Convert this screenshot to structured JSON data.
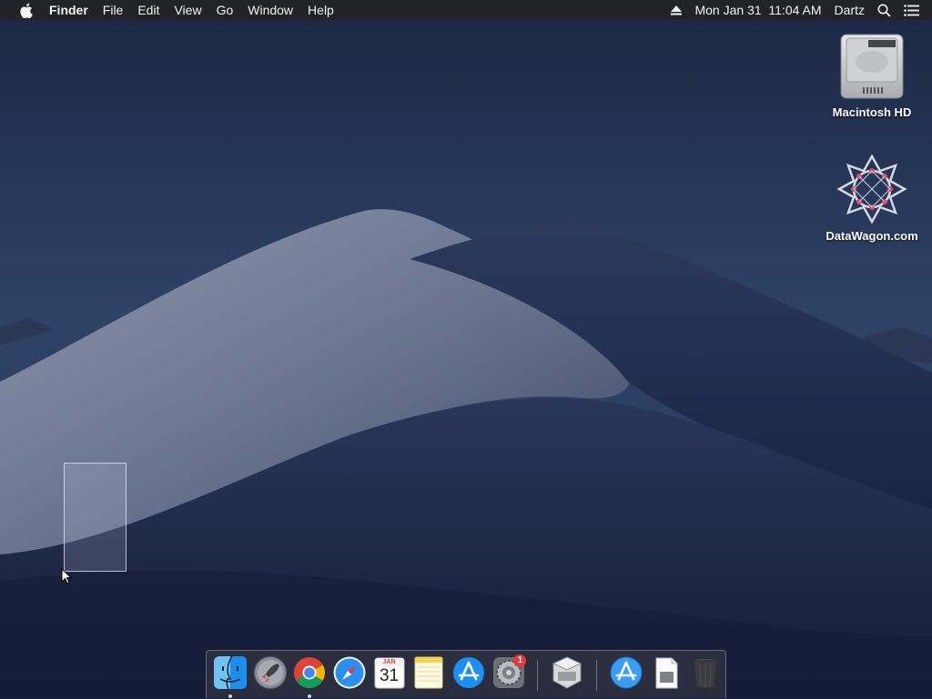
{
  "menubar": {
    "app_name": "Finder",
    "menus": [
      "File",
      "Edit",
      "View",
      "Go",
      "Window",
      "Help"
    ],
    "datetime": "Mon Jan 31  11:04 AM",
    "user": "Dartz"
  },
  "desktop_icons": [
    {
      "label": "Macintosh HD",
      "icon": "hard-drive-icon"
    },
    {
      "label": "DataWagon.com",
      "icon": "disk-image-icon"
    }
  ],
  "dock": {
    "items": [
      {
        "name": "Finder",
        "icon": "finder-icon",
        "running": true
      },
      {
        "name": "Launchpad",
        "icon": "launchpad-icon",
        "running": false
      },
      {
        "name": "Google Chrome",
        "icon": "chrome-icon",
        "running": true
      },
      {
        "name": "Safari",
        "icon": "safari-icon",
        "running": false
      },
      {
        "name": "Calendar",
        "icon": "calendar-icon",
        "running": false,
        "month": "JAN",
        "day": "31"
      },
      {
        "name": "Notes",
        "icon": "notes-icon",
        "running": false
      },
      {
        "name": "App Store",
        "icon": "app-store-icon",
        "running": false
      },
      {
        "name": "System Preferences",
        "icon": "system-preferences-icon",
        "running": false,
        "badge": "1"
      },
      {
        "name": "Installer Package",
        "icon": "installer-icon",
        "running": false
      },
      {
        "name": "Applications",
        "icon": "applications-folder-icon",
        "running": false
      },
      {
        "name": "Document",
        "icon": "document-icon",
        "running": false
      },
      {
        "name": "Trash",
        "icon": "trash-icon",
        "running": false
      }
    ]
  },
  "colors": {
    "menubar_bg": "#232326",
    "badge_red": "#e5383b",
    "wallpaper_sky": "#283a5e"
  }
}
